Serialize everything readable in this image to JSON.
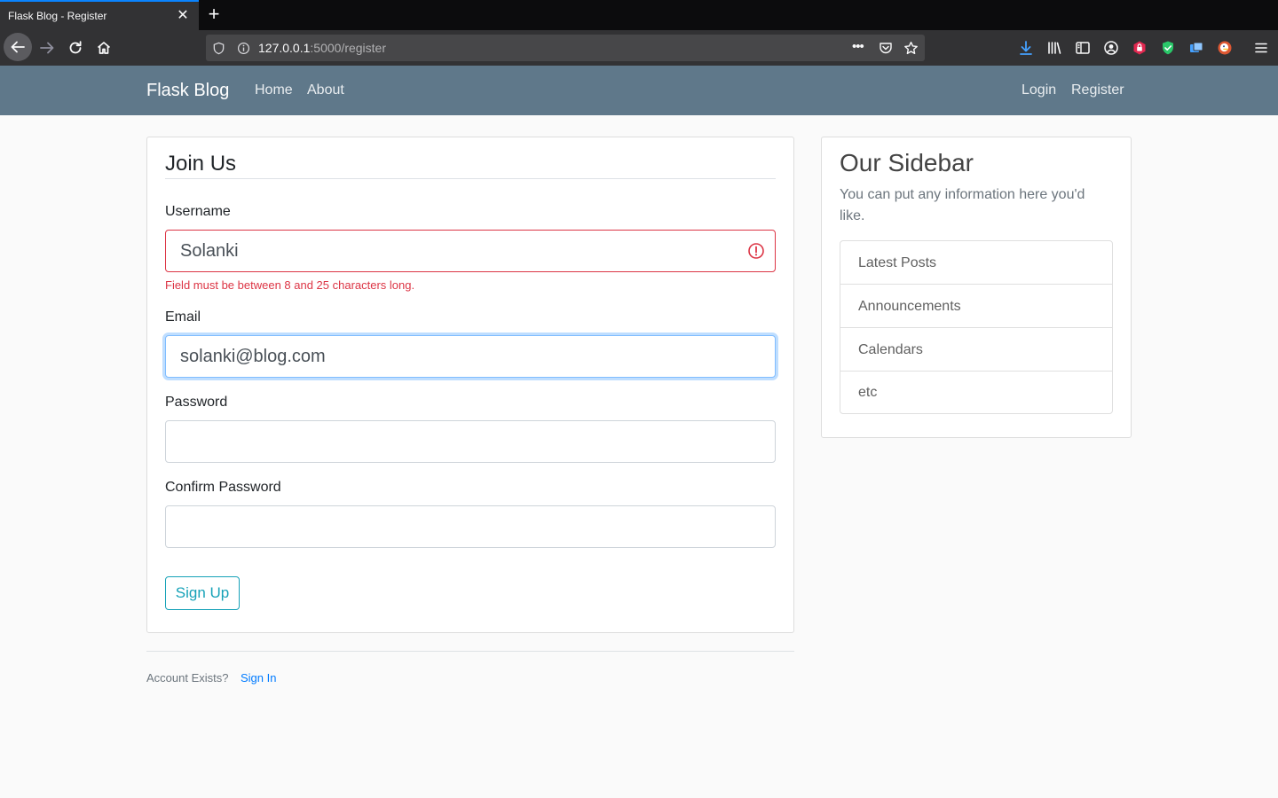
{
  "browser": {
    "tab_title": "Flask Blog - Register",
    "tab_close": "✕",
    "new_tab": "+",
    "url_host": "127.0.0.1",
    "url_rest": ":5000/register",
    "page_actions": "•••",
    "accent_color": "#0a84ff"
  },
  "site_nav": {
    "brand": "Flask Blog",
    "links_left": [
      "Home",
      "About"
    ],
    "links_right": [
      "Login",
      "Register"
    ],
    "background": "#5f788a"
  },
  "form": {
    "legend": "Join Us",
    "username": {
      "label": "Username",
      "value": "Solanki",
      "error": "Field must be between 8 and 25 characters long."
    },
    "email": {
      "label": "Email",
      "value": "solanki@blog.com"
    },
    "password": {
      "label": "Password",
      "value": ""
    },
    "confirm_password": {
      "label": "Confirm Password",
      "value": ""
    },
    "submit_label": "Sign Up",
    "error_color": "#dc3545",
    "button_color": "#17a2b8"
  },
  "footer": {
    "account_text": "Account Exists?",
    "signin_label": "Sign In"
  },
  "sidebar": {
    "title": "Our Sidebar",
    "text": "You can put any information here you'd like.",
    "items": [
      "Latest Posts",
      "Announcements",
      "Calendars",
      "etc"
    ]
  }
}
